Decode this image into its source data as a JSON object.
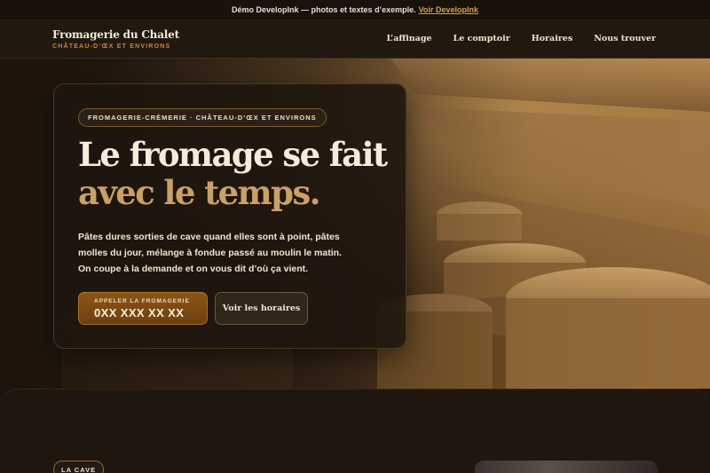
{
  "demo_bar": {
    "text": "Démo DevelopInk — photos et textes d’exemple.",
    "link": "Voir DevelopInk"
  },
  "header": {
    "brand_name": "Fromagerie du Chalet",
    "brand_sub": "CHÂTEAU-D’ŒX ET ENVIRONS",
    "nav": [
      "L’affinage",
      "Le comptoir",
      "Horaires",
      "Nous trouver"
    ]
  },
  "hero": {
    "badge": "FROMAGERIE-CRÈMERIE · CHÂTEAU-D’ŒX ET ENVIRONS",
    "headline_line1": "Le fromage se fait",
    "headline_line2": "avec le temps.",
    "lead": "Pâtes dures sorties de cave quand elles sont à point, pâtes molles du jour, mélange à fondue passé au moulin le matin. On coupe à la demande et on vous dit d’où ça vient.",
    "call_button_label": "APPELER LA FROMAGERIE",
    "call_button_number": "0XX XXX XX XX",
    "hours_button": "Voir les horaires"
  },
  "section2": {
    "tag": "LA CAVE"
  },
  "colors": {
    "accent": "#c98a2e",
    "headline_accent": "#c9a067",
    "background": "#1c140e"
  }
}
